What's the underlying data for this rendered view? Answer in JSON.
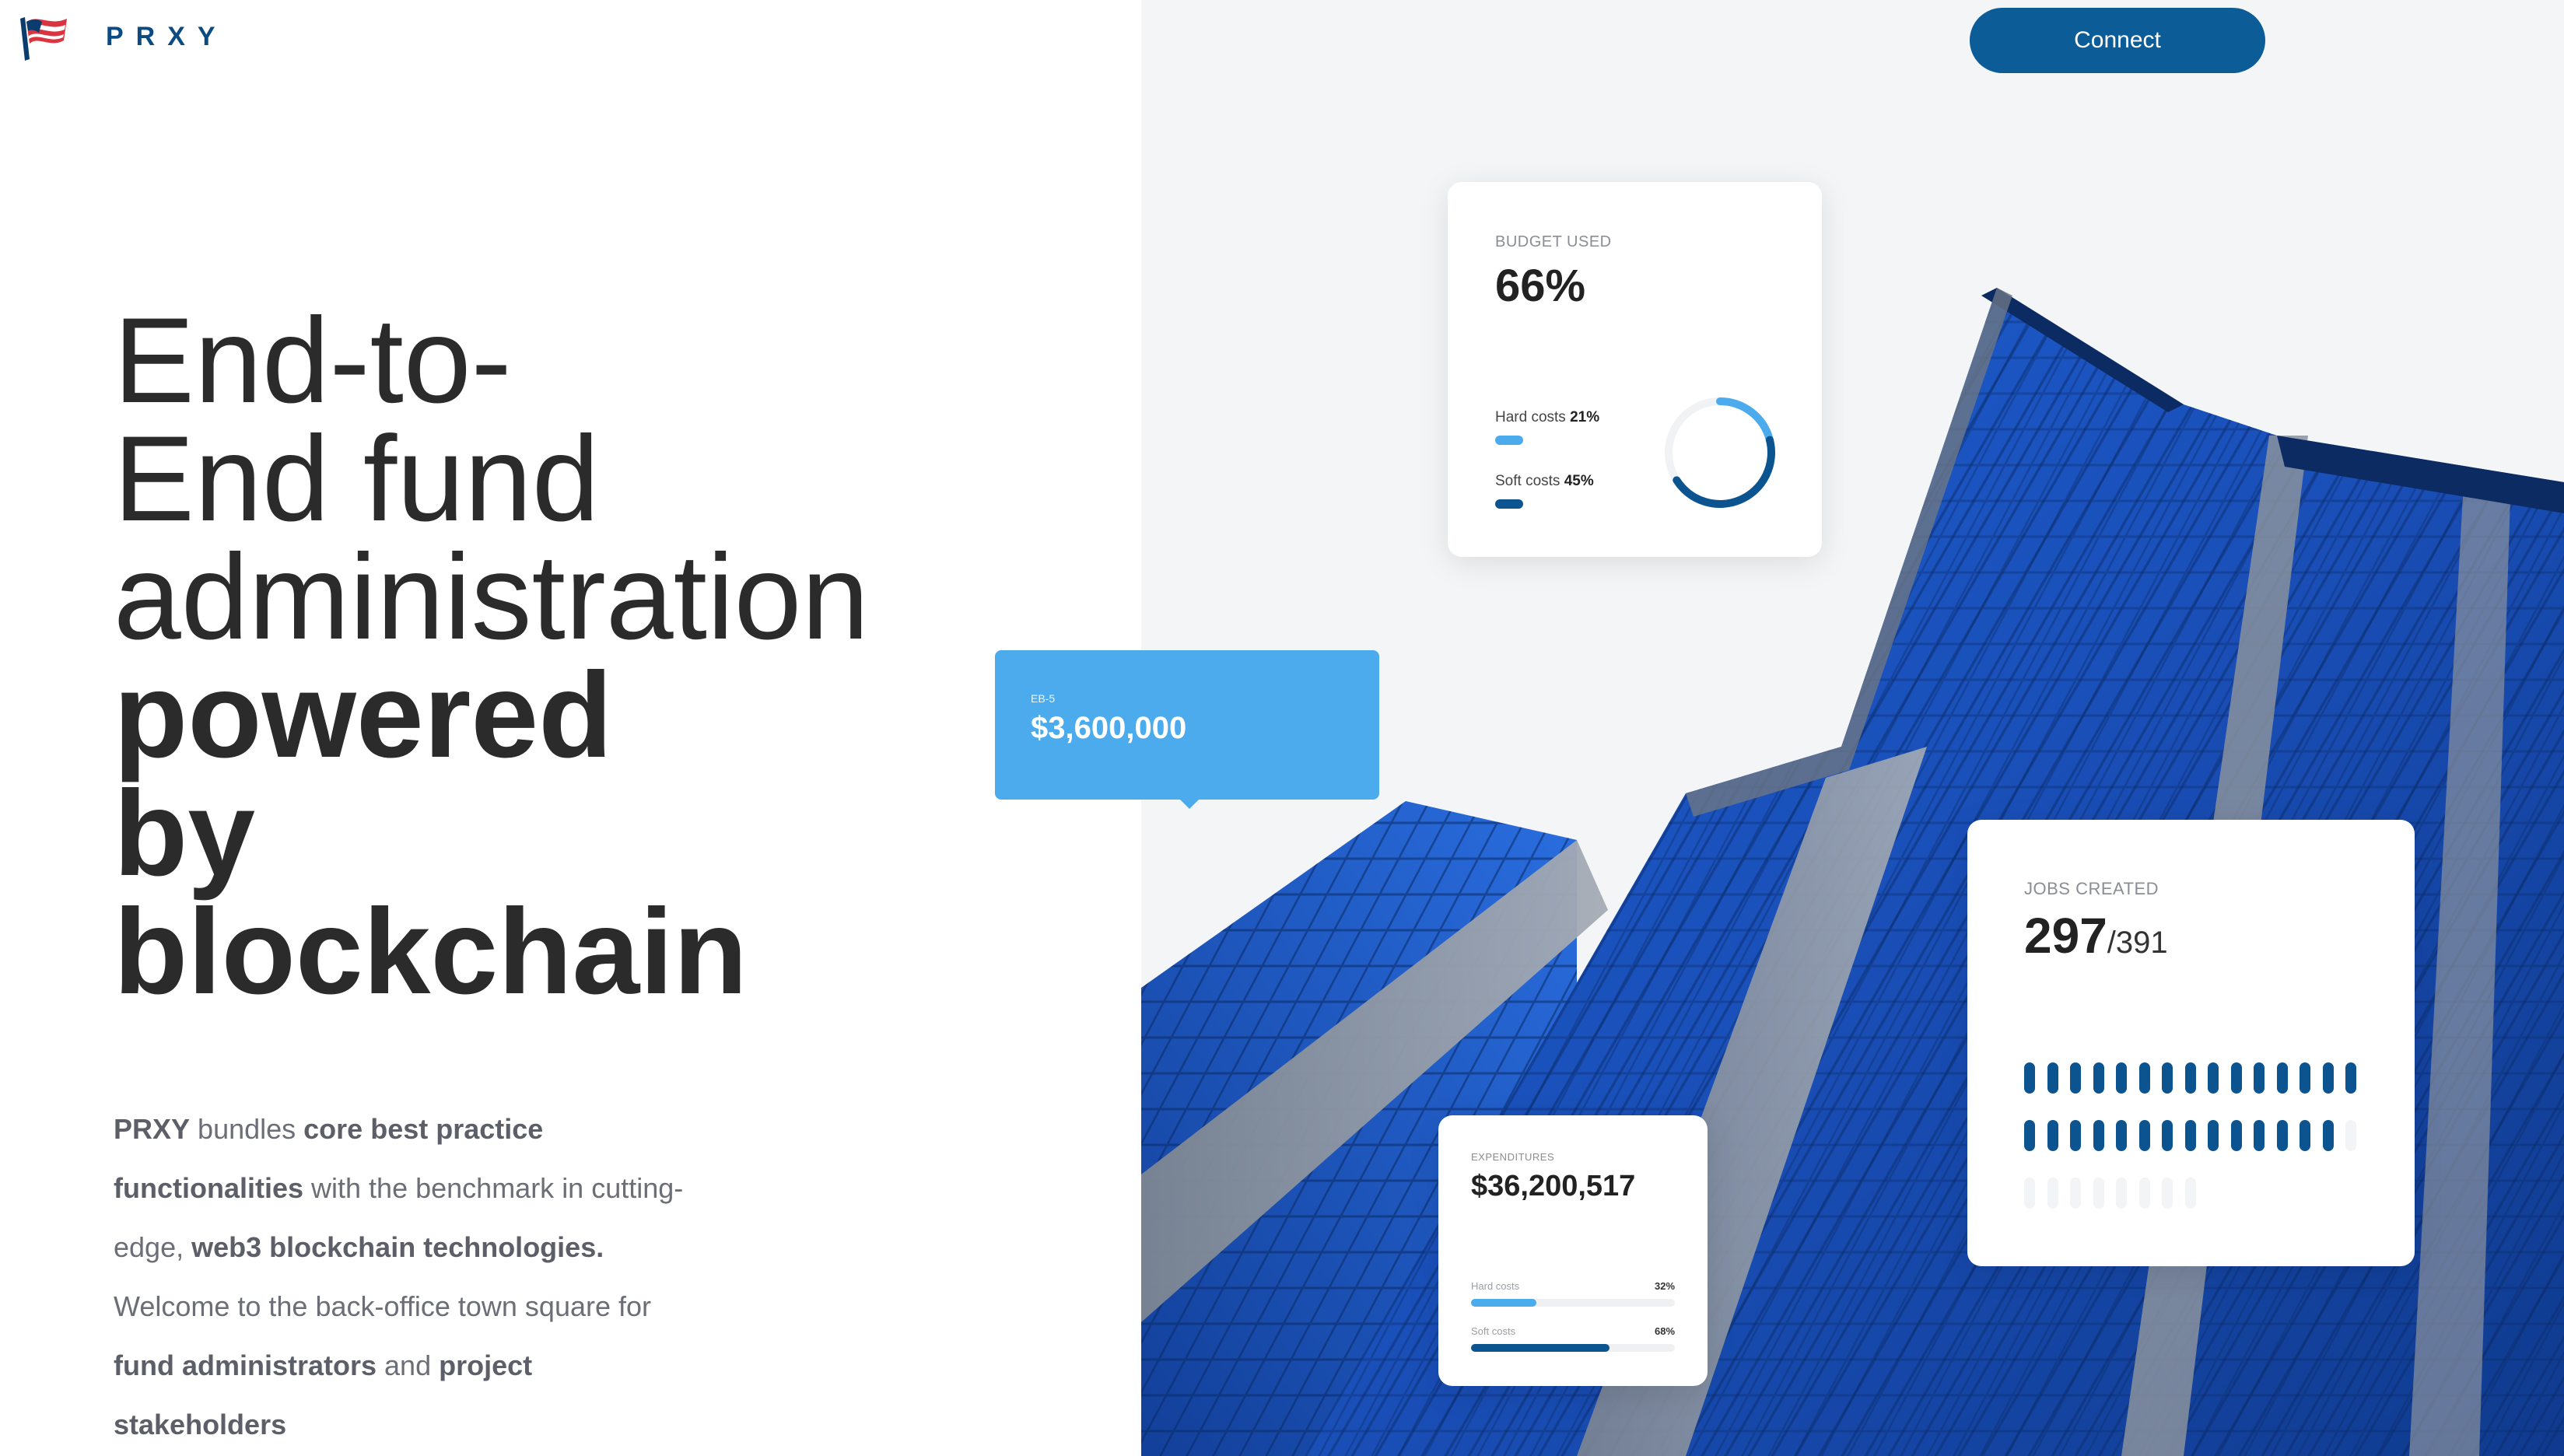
{
  "brand": {
    "name": "PRXY",
    "logo": "flag-logo-icon"
  },
  "header": {
    "connect_label": "Connect"
  },
  "hero": {
    "line1": "End-to-",
    "line2": "End fund",
    "line3": "administration",
    "line4": "powered",
    "line5": "by",
    "line6": "blockchain"
  },
  "intro": {
    "s1": "PRXY",
    "s2": " bundles ",
    "s3": "core best practice functionalities",
    "s4": "  with the benchmark in cutting-edge, ",
    "s5": "web3 blockchain technologies.",
    "s6": " Welcome to the back-office town square for ",
    "s7": "fund administrators",
    "s8": "  and ",
    "s9": "project stakeholders"
  },
  "budget_card": {
    "label": "BUDGET USED",
    "value": "66%",
    "hard_label": "Hard costs ",
    "hard_pct": "21%",
    "soft_label": "Soft costs ",
    "soft_pct": "45%",
    "hard_fraction": 0.21,
    "soft_fraction": 0.45
  },
  "eb5_card": {
    "label": "EB-5",
    "value": "$3,600,000"
  },
  "jobs_card": {
    "label": "JOBS CREATED",
    "value": "297",
    "total": "/391",
    "filled": 297,
    "max": 391
  },
  "expenditures_card": {
    "label": "EXPENDITURES",
    "value": "$36,200,517",
    "hard_label": "Hard costs",
    "hard_pct": "32%",
    "soft_label": "Soft costs",
    "soft_pct": "68%",
    "hard_fraction": 0.32,
    "soft_fraction": 0.68
  },
  "colors": {
    "brand_blue": "#0b5c97",
    "light_blue": "#4cabec",
    "dark_blue": "#0c5490"
  }
}
